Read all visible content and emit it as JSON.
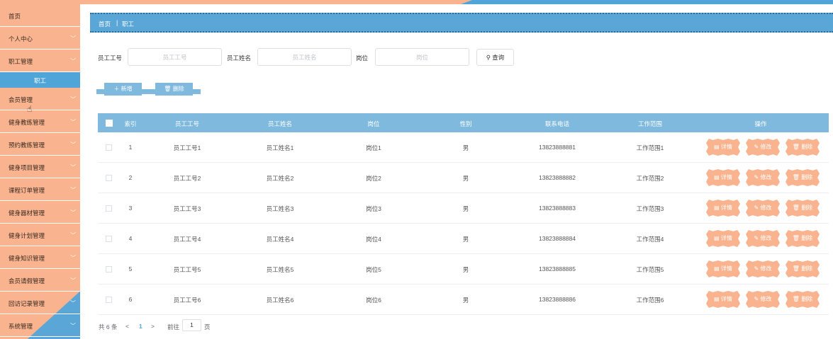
{
  "sidebar": {
    "items": [
      {
        "label": "首页",
        "chevron": false
      },
      {
        "label": "个人中心",
        "chevron": true
      },
      {
        "label": "职工管理",
        "chevron": true
      },
      {
        "label": "会员管理",
        "chevron": true
      },
      {
        "label": "健身教练管理",
        "chevron": true
      },
      {
        "label": "预约教练管理",
        "chevron": true
      },
      {
        "label": "健身项目管理",
        "chevron": true
      },
      {
        "label": "课程订单管理",
        "chevron": true
      },
      {
        "label": "健身器材管理",
        "chevron": true
      },
      {
        "label": "健身计划管理",
        "chevron": true
      },
      {
        "label": "健身知识管理",
        "chevron": true
      },
      {
        "label": "会员请假管理",
        "chevron": true
      },
      {
        "label": "回访记录管理",
        "chevron": true
      },
      {
        "label": "系统管理",
        "chevron": true
      }
    ],
    "active_sub": "职工"
  },
  "breadcrumb": {
    "home": "首页",
    "separator": "|",
    "current": "职工"
  },
  "search": {
    "fields": [
      {
        "label": "员工工号",
        "placeholder": "员工工号"
      },
      {
        "label": "员工姓名",
        "placeholder": "员工姓名"
      },
      {
        "label": "岗位",
        "placeholder": "岗位"
      }
    ],
    "button": "查询"
  },
  "actions": {
    "add": "新增",
    "delete": "删除"
  },
  "table": {
    "headers": [
      "索引",
      "员工工号",
      "员工姓名",
      "岗位",
      "性别",
      "联系电话",
      "工作范围",
      "操作"
    ],
    "rows": [
      [
        "1",
        "员工工号1",
        "员工姓名1",
        "岗位1",
        "男",
        "13823888881",
        "工作范围1"
      ],
      [
        "2",
        "员工工号2",
        "员工姓名2",
        "岗位2",
        "男",
        "13823888882",
        "工作范围2"
      ],
      [
        "3",
        "员工工号3",
        "员工姓名3",
        "岗位3",
        "男",
        "13823888883",
        "工作范围3"
      ],
      [
        "4",
        "员工工号4",
        "员工姓名4",
        "岗位4",
        "男",
        "13823888884",
        "工作范围4"
      ],
      [
        "5",
        "员工工号5",
        "员工姓名5",
        "岗位5",
        "男",
        "13823888885",
        "工作范围5"
      ],
      [
        "6",
        "员工工号6",
        "员工姓名6",
        "岗位6",
        "男",
        "13823888886",
        "工作范围6"
      ]
    ],
    "row_actions": {
      "detail": "详情",
      "edit": "修改",
      "delete": "删除"
    }
  },
  "pagination": {
    "total_text": "共 6 条",
    "prev": "<",
    "current_page": "1",
    "next": ">",
    "goto_label": "前往",
    "goto_value": "1",
    "page_unit": "页"
  },
  "colors": {
    "sidebar_bg": "#f9b48f",
    "accent_blue": "#4fa5d8",
    "table_header": "#7fb9dd",
    "button_orange": "#f9b48f"
  },
  "icons": {
    "search": "search-icon",
    "add": "plus-icon",
    "delete": "trash-icon",
    "detail": "document-icon",
    "edit": "pencil-icon",
    "chevron": "chevron-down-icon"
  }
}
